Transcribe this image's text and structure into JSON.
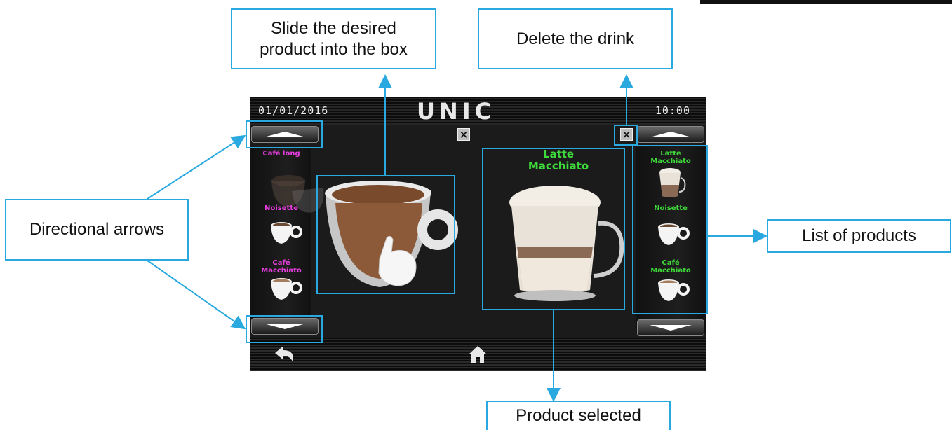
{
  "annotations": {
    "slide": "Slide the desired product into the box",
    "slide_line1": "Slide the desired",
    "slide_line2": "product into the box",
    "delete": "Delete the drink",
    "directional": "Directional arrows",
    "list": "List of products",
    "selected": "Product selected"
  },
  "screen": {
    "date": "01/01/2016",
    "logo": "UNIC",
    "time": "10:00",
    "left_products": [
      {
        "name": "Café long"
      },
      {
        "name": "Noisette"
      },
      {
        "name": "Café Macchiato"
      }
    ],
    "right_products": [
      {
        "name": "Latte Macchiato"
      },
      {
        "name": "Noisette"
      },
      {
        "name": "Café Macchiato"
      }
    ],
    "selected_product_line1": "Latte",
    "selected_product_line2": "Macchiato",
    "left_label_lines": {
      "cafe_long": "Café long",
      "noisette": "Noisette",
      "cafe_m1": "Café",
      "cafe_m2": "Macchiato"
    },
    "right_label_lines": {
      "latte1": "Latte",
      "latte2": "Macchiato",
      "noisette": "Noisette",
      "cafe_m1": "Café",
      "cafe_m2": "Macchiato"
    }
  },
  "colors": {
    "annotation": "#29a9e0",
    "left_label": "#e83ee0",
    "right_label": "#3ed93a"
  },
  "icons": [
    "up-arrow-icon",
    "down-arrow-icon",
    "close-icon",
    "back-icon",
    "home-icon",
    "hand-icon"
  ]
}
